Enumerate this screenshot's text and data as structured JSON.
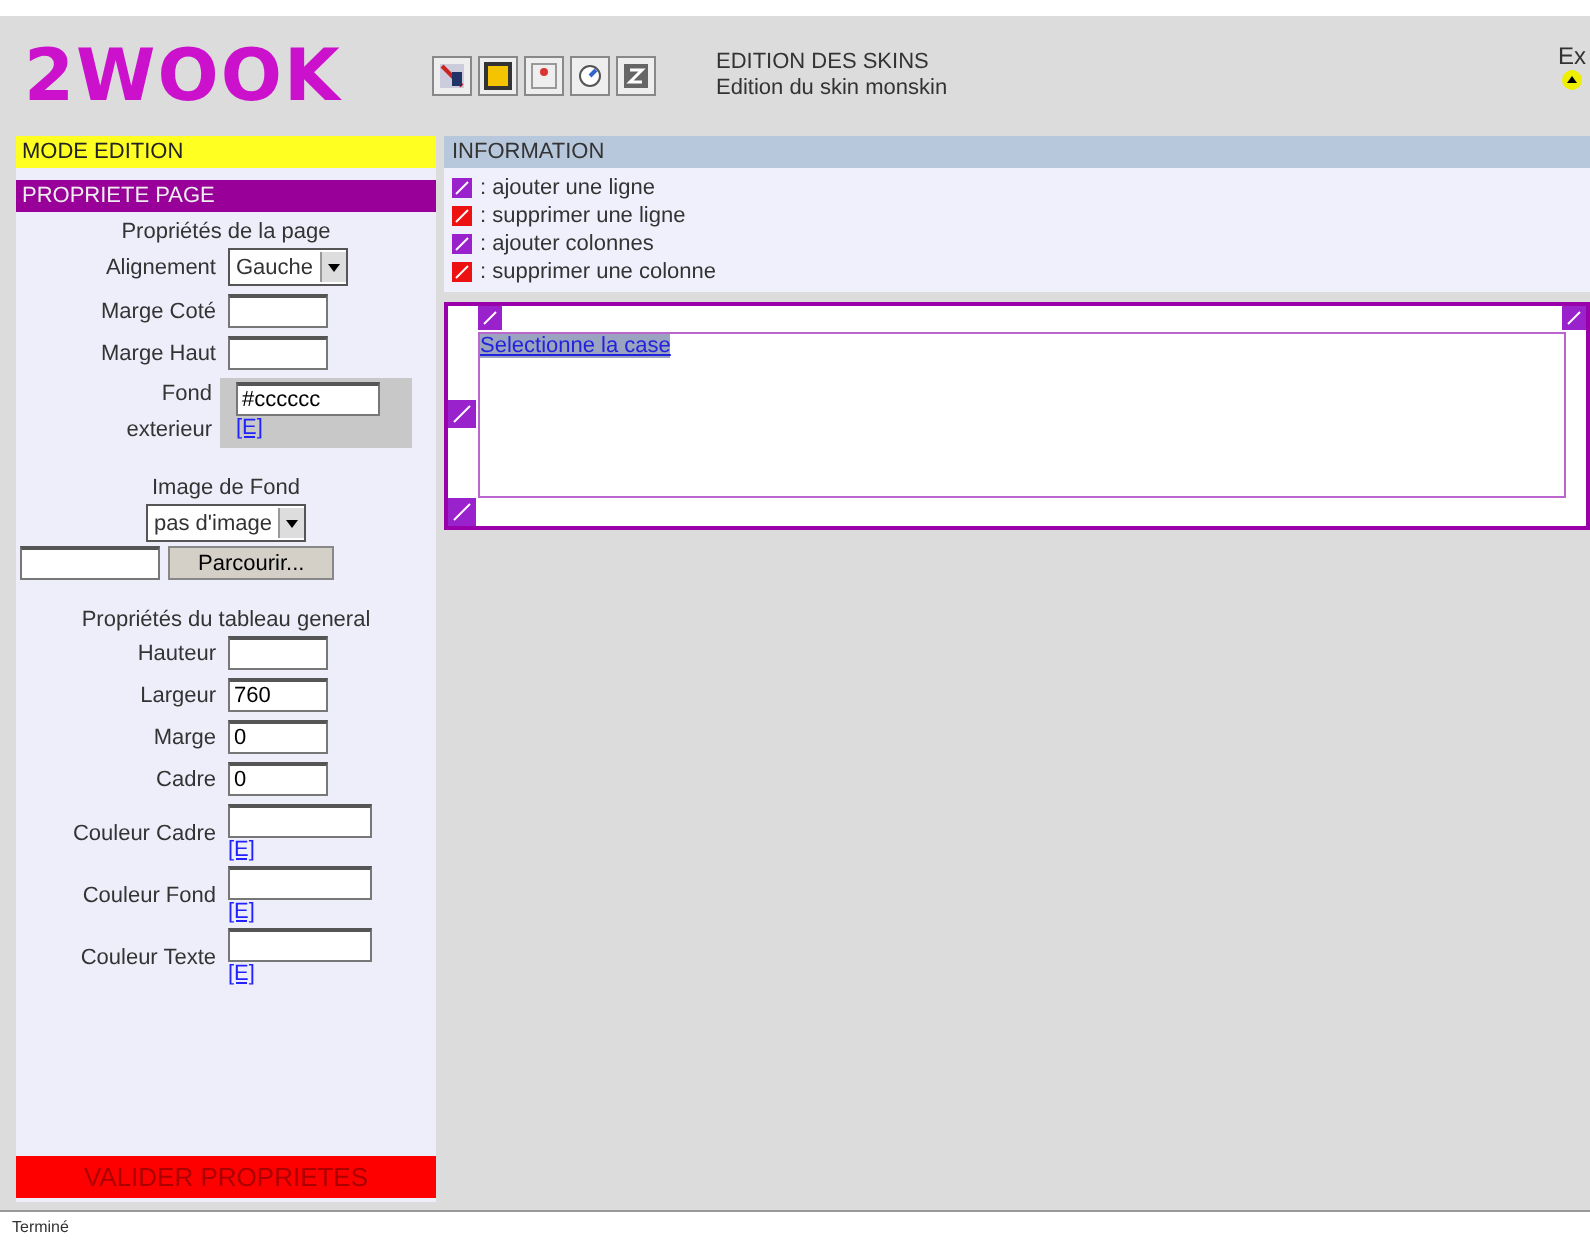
{
  "header": {
    "logo": "2WOOK",
    "toolbar_icons": [
      {
        "kind": "pencil"
      },
      {
        "kind": "frame"
      },
      {
        "kind": "image"
      },
      {
        "kind": "clock"
      },
      {
        "kind": "z"
      }
    ],
    "title": "EDITION DES SKINS",
    "subtitle": "Edition du skin monskin",
    "corner_text": "Ex"
  },
  "sidebar": {
    "mode": "MODE EDITION",
    "panel_title": "PROPRIETE PAGE",
    "page_section": "Propriétés de la page",
    "alignment": {
      "label": "Alignement",
      "value": "Gauche"
    },
    "marge_cote": {
      "label": "Marge Coté"
    },
    "marge_haut": {
      "label": "Marge Haut"
    },
    "fond_exterieur": {
      "label_1": "Fond",
      "label_2": "exterieur",
      "value": "#cccccc",
      "link": "[E]"
    },
    "image_label": "Image de Fond",
    "image_select": "pas d'image",
    "browse": "Parcourir...",
    "table_section": "Propriétés du tableau general",
    "table_fields": [
      {
        "kind": "plain",
        "label": "Hauteur"
      },
      {
        "kind": "plain",
        "label": "Largeur",
        "value": "760"
      },
      {
        "kind": "plain",
        "label": "Marge",
        "value": "0"
      },
      {
        "kind": "plain",
        "label": "Cadre",
        "value": "0"
      },
      {
        "kind": "color",
        "label": "Couleur Cadre",
        "link": "[E]"
      },
      {
        "kind": "color",
        "label": "Couleur Fond",
        "link": "[E]"
      },
      {
        "kind": "color",
        "label": "Couleur Texte",
        "link": "[E]"
      }
    ],
    "submit": "VALIDER PROPRIETES"
  },
  "info": {
    "title": "INFORMATION",
    "items": [
      {
        "kind": "add",
        "text": ": ajouter une ligne"
      },
      {
        "kind": "delete",
        "text": ": supprimer une ligne"
      },
      {
        "kind": "add",
        "text": ": ajouter colonnes"
      },
      {
        "kind": "delete",
        "text": ": supprimer une colonne"
      }
    ]
  },
  "editor": {
    "cell_link": "Selectionne la case"
  },
  "status_bar": "Terminé"
}
